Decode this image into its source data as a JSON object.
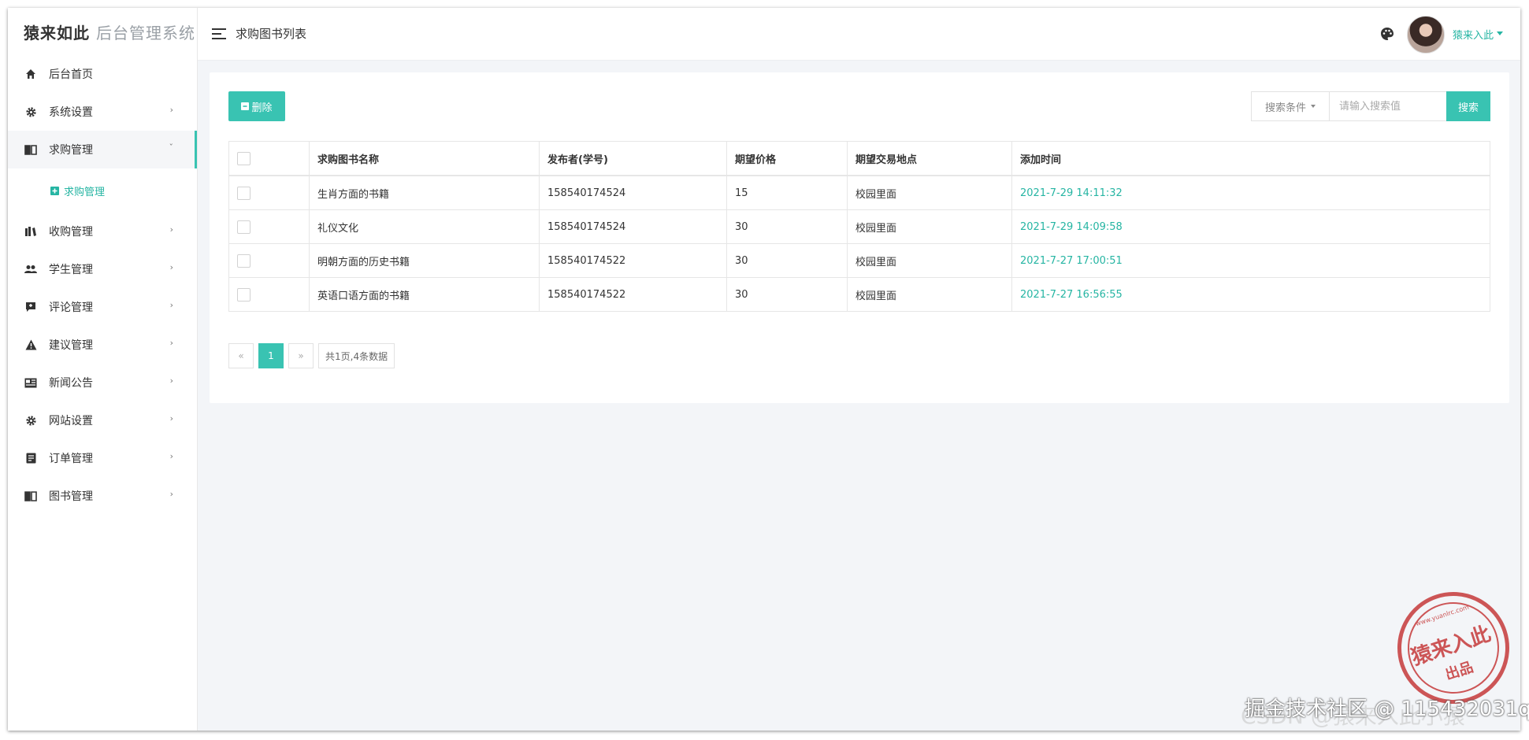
{
  "brand": {
    "name": "猿来如此",
    "subtitle": "后台管理系统"
  },
  "header": {
    "title": "求购图书列表",
    "username": "猿来入此"
  },
  "sidebar": {
    "items": [
      {
        "label": "后台首页",
        "icon": "home-icon",
        "has_children": false
      },
      {
        "label": "系统设置",
        "icon": "gear-icon",
        "has_children": true
      },
      {
        "label": "求购管理",
        "icon": "book-icon",
        "has_children": true,
        "active": true
      },
      {
        "label": "收购管理",
        "icon": "book-stack-icon",
        "has_children": true
      },
      {
        "label": "学生管理",
        "icon": "users-icon",
        "has_children": true
      },
      {
        "label": "评论管理",
        "icon": "comment-icon",
        "has_children": true
      },
      {
        "label": "建议管理",
        "icon": "warning-icon",
        "has_children": true
      },
      {
        "label": "新闻公告",
        "icon": "news-icon",
        "has_children": true
      },
      {
        "label": "网站设置",
        "icon": "gear-icon",
        "has_children": true
      },
      {
        "label": "订单管理",
        "icon": "list-icon",
        "has_children": true
      },
      {
        "label": "图书管理",
        "icon": "book-icon",
        "has_children": true
      }
    ],
    "submenu": {
      "label": "求购管理"
    }
  },
  "toolbar": {
    "delete_label": "删除"
  },
  "search": {
    "condition_label": "搜索条件",
    "placeholder": "请输入搜索值",
    "button_label": "搜索"
  },
  "table": {
    "columns": [
      "求购图书名称",
      "发布者(学号)",
      "期望价格",
      "期望交易地点",
      "添加时间"
    ],
    "rows": [
      [
        "生肖方面的书籍",
        "158540174524",
        "15",
        "校园里面",
        "2021-7-29 14:11:32"
      ],
      [
        "礼仪文化",
        "158540174524",
        "30",
        "校园里面",
        "2021-7-29 14:09:58"
      ],
      [
        "明朝方面的历史书籍",
        "158540174522",
        "30",
        "校园里面",
        "2021-7-27 17:00:51"
      ],
      [
        "英语口语方面的书籍",
        "158540174522",
        "30",
        "校园里面",
        "2021-7-27 16:56:55"
      ]
    ]
  },
  "pagination": {
    "prev": "«",
    "current": "1",
    "next": "»",
    "info": "共1页,4条数据"
  },
  "stamp": {
    "main": "猿来入此",
    "sub": "出品",
    "url": "www.yuanlrc.com"
  },
  "watermark": {
    "text": "掘金技术社区 @ 115432031q",
    "text2": "CSDN @猿来入此小猿"
  },
  "colors": {
    "accent": "#39c3b2",
    "time_text": "#26b5a3",
    "stamp": "#c63a3a"
  }
}
